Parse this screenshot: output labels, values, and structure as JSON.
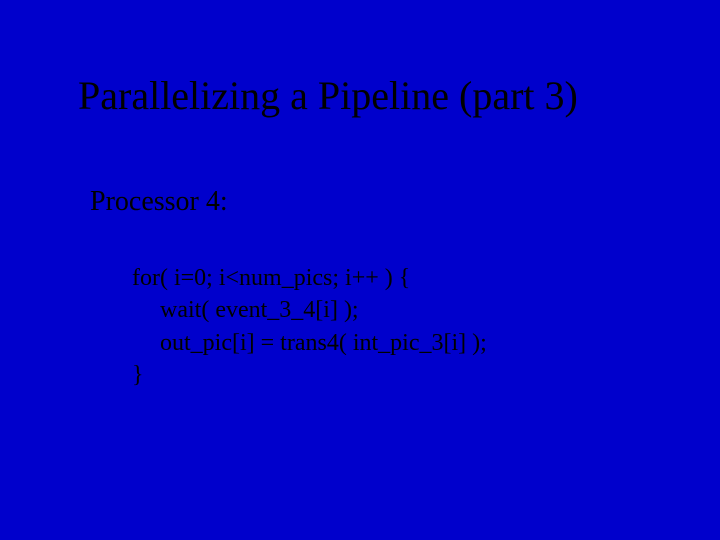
{
  "title": "Parallelizing a Pipeline (part 3)",
  "subtitle": "Processor 4:",
  "code": {
    "l1": "for( i=0; i<num_pics; i++ ) {",
    "l2": "wait( event_3_4[i] );",
    "l3": "out_pic[i] = trans4( int_pic_3[i] );",
    "l4": "}"
  }
}
